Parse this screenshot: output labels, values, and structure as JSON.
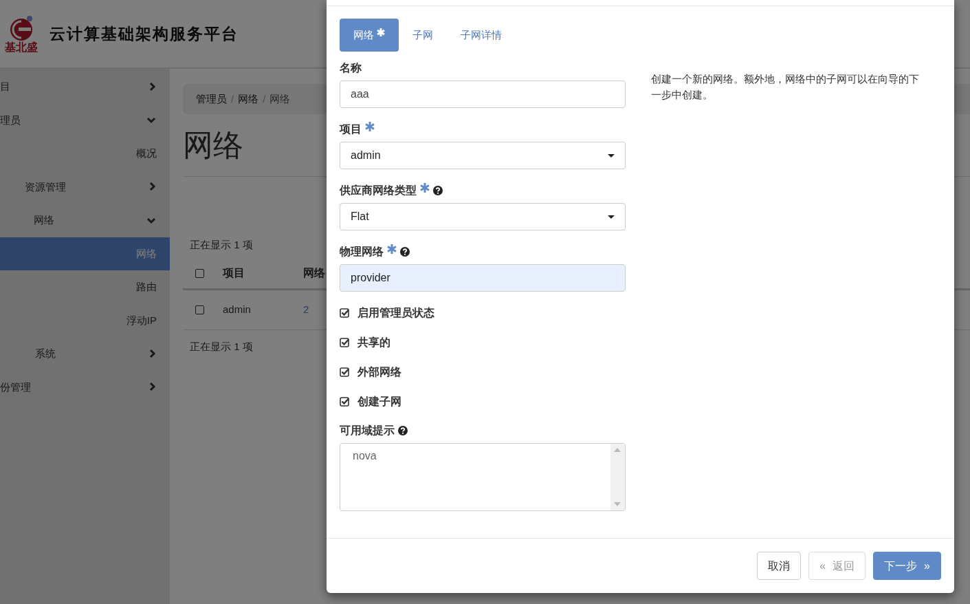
{
  "header": {
    "logo_text": "基北盛",
    "title": "云计算基础架构服务平台"
  },
  "sidebar": {
    "items": [
      {
        "label": "目",
        "kind": "group",
        "expanded": false,
        "selected": false
      },
      {
        "label": "理员",
        "kind": "group",
        "expanded": true,
        "selected": false,
        "children": [
          {
            "label": "概况",
            "kind": "leaf",
            "selected": false
          },
          {
            "label": "资源管理",
            "kind": "group",
            "expanded": false,
            "selected": false
          },
          {
            "label": "网络",
            "kind": "group",
            "expanded": true,
            "selected": false,
            "children": [
              {
                "label": "网络",
                "kind": "leaf",
                "selected": true
              },
              {
                "label": "路由",
                "kind": "leaf",
                "selected": false
              },
              {
                "label": "浮动IP",
                "kind": "leaf",
                "selected": false
              }
            ]
          },
          {
            "label": "系统",
            "kind": "group",
            "expanded": false,
            "selected": false
          }
        ]
      },
      {
        "label": "份管理",
        "kind": "group",
        "expanded": false,
        "selected": false
      }
    ]
  },
  "content": {
    "breadcrumb": {
      "separator": "/",
      "items": [
        "管理员",
        "网络",
        "网络"
      ]
    },
    "page_title": "网络",
    "summary_top": "正在显示 1 项",
    "table": {
      "select_all": false,
      "columns": [
        "项目",
        "网络"
      ],
      "rows": [
        {
          "selected": false,
          "cells": [
            "admin",
            "2"
          ]
        }
      ]
    },
    "summary_bottom": "正在显示 1 项"
  },
  "modal": {
    "tabs": [
      {
        "label": "网络",
        "required": true,
        "selected": true
      },
      {
        "label": "子网",
        "required": false,
        "selected": false
      },
      {
        "label": "子网详情",
        "required": false,
        "selected": false
      }
    ],
    "fields": [
      {
        "kind": "text",
        "label": "名称",
        "value": "aaa",
        "autofilled": false
      },
      {
        "kind": "select",
        "label": "项目",
        "required": true,
        "value": "admin"
      },
      {
        "kind": "select",
        "label": "供应商网络类型",
        "required": true,
        "help": true,
        "value": "Flat"
      },
      {
        "kind": "text",
        "label": "物理网络",
        "required": true,
        "help": true,
        "value": "provider",
        "autofilled": true
      },
      {
        "kind": "checkbox",
        "label": "启用管理员状态",
        "checked": true
      },
      {
        "kind": "checkbox",
        "label": "共享的",
        "checked": true
      },
      {
        "kind": "checkbox",
        "label": "外部网络",
        "checked": true
      },
      {
        "kind": "checkbox",
        "label": "创建子网",
        "checked": true
      },
      {
        "kind": "listbox",
        "label": "可用域提示",
        "help": true,
        "options": [
          "nova"
        ]
      }
    ],
    "description": "创建一个新的网络。额外地，网络中的子网可以在向导的下一步中创建。",
    "buttons": [
      {
        "kind": "default",
        "label": "取消",
        "disabled": false
      },
      {
        "kind": "back",
        "label": "返回",
        "prefix": "«",
        "disabled": true
      },
      {
        "kind": "primary",
        "label": "下一步",
        "suffix": "»",
        "disabled": false
      }
    ]
  }
}
